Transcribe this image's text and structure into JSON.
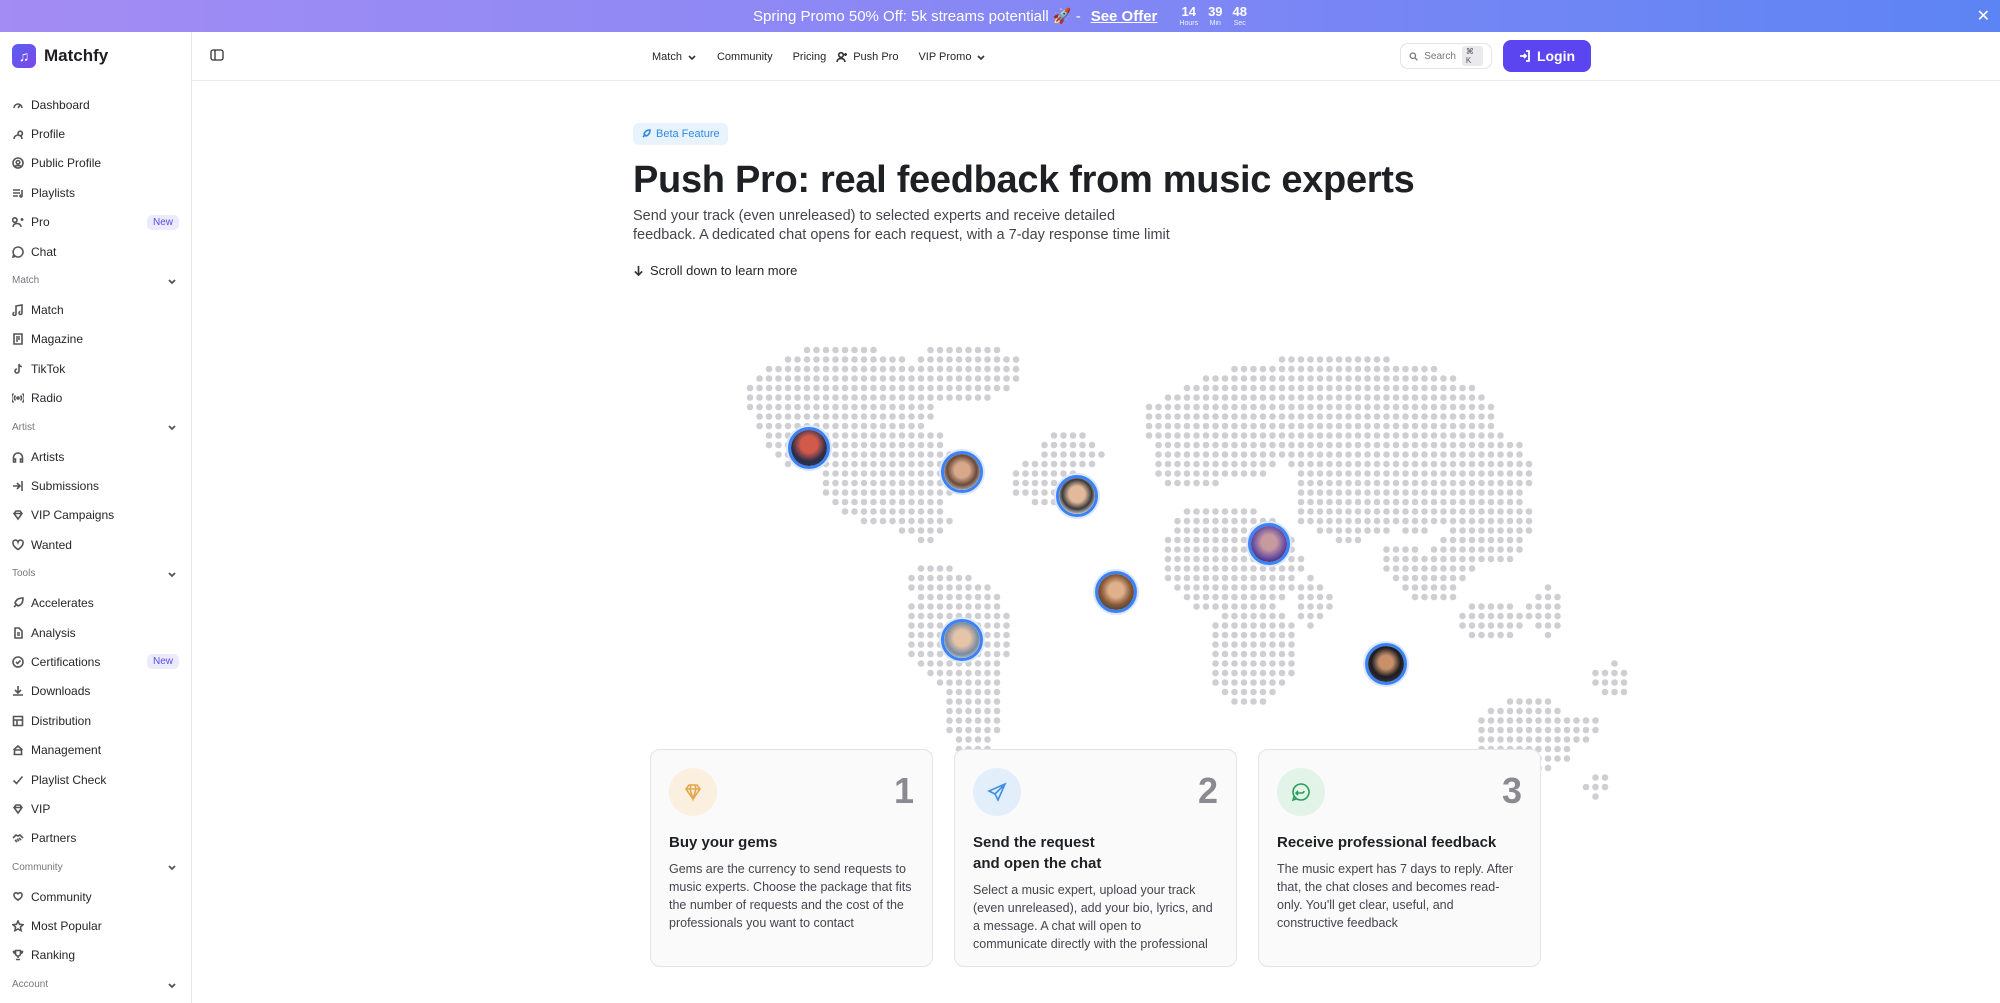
{
  "promo": {
    "text": "Spring Promo 50% Off: 5k streams potentiall 🚀 -",
    "offer": "See Offer",
    "timer": [
      {
        "value": "14",
        "label": "Hours"
      },
      {
        "value": "39",
        "label": "Min"
      },
      {
        "value": "48",
        "label": "Sec"
      }
    ],
    "close": "✕"
  },
  "brand": {
    "name": "Matchfy"
  },
  "sidebar": {
    "main": [
      {
        "label": "Dashboard",
        "icon": "dashboard-icon"
      },
      {
        "label": "Profile",
        "icon": "user-icon"
      },
      {
        "label": "Public Profile",
        "icon": "user-circle-icon"
      },
      {
        "label": "Playlists",
        "icon": "playlist-icon"
      },
      {
        "label": "Pro",
        "icon": "user-plus-icon",
        "badge": "New"
      },
      {
        "label": "Chat",
        "icon": "chat-icon"
      }
    ],
    "sections": [
      {
        "title": "Match",
        "items": [
          {
            "label": "Match",
            "icon": "music-note-icon"
          },
          {
            "label": "Magazine",
            "icon": "magazine-icon"
          },
          {
            "label": "TikTok",
            "icon": "tiktok-icon"
          },
          {
            "label": "Radio",
            "icon": "radio-icon"
          }
        ]
      },
      {
        "title": "Artist",
        "items": [
          {
            "label": "Artists",
            "icon": "headphones-icon"
          },
          {
            "label": "Submissions",
            "icon": "submit-icon"
          },
          {
            "label": "VIP Campaigns",
            "icon": "diamond-icon"
          },
          {
            "label": "Wanted",
            "icon": "heart-icon"
          }
        ]
      },
      {
        "title": "Tools",
        "items": [
          {
            "label": "Accelerates",
            "icon": "rocket-icon"
          },
          {
            "label": "Analysis",
            "icon": "document-icon"
          },
          {
            "label": "Certifications",
            "icon": "certificate-icon",
            "badge": "New"
          },
          {
            "label": "Downloads",
            "icon": "download-icon"
          },
          {
            "label": "Distribution",
            "icon": "distribution-icon"
          },
          {
            "label": "Management",
            "icon": "management-icon"
          },
          {
            "label": "Playlist Check",
            "icon": "check-icon"
          },
          {
            "label": "VIP",
            "icon": "diamond-icon"
          },
          {
            "label": "Partners",
            "icon": "handshake-icon"
          }
        ]
      },
      {
        "title": "Community",
        "items": [
          {
            "label": "Community",
            "icon": "heart-hand-icon"
          },
          {
            "label": "Most Popular",
            "icon": "star-icon"
          },
          {
            "label": "Ranking",
            "icon": "trophy-icon"
          }
        ]
      },
      {
        "title": "Account",
        "items": []
      }
    ]
  },
  "topnav": {
    "match": "Match",
    "community": "Community",
    "pricing": "Pricing",
    "push_pro": "Push Pro",
    "vip_promo": "VIP Promo",
    "search_label": "Search",
    "search_kbd": "⌘ K",
    "login": "Login"
  },
  "hero": {
    "badge": "Beta Feature",
    "title": "Push Pro: real feedback from music experts",
    "subtitle": "Send your track (even unreleased) to selected experts and receive detailed feedback. A dedicated chat opens for each request, with a 7-day response time limit",
    "scroll": "Scroll down to learn more"
  },
  "steps": [
    {
      "num": "1",
      "title": "Buy your gems",
      "body": "Gems are the currency to send requests to music experts. Choose the package that fits the number of requests and the cost of the professionals you want to contact",
      "icon": "gem-icon",
      "color": "#e2a84b",
      "bg": "#fbefe0"
    },
    {
      "num": "2",
      "title": "Send the request and open the chat",
      "body": "Select a music expert, upload your track (even unreleased), add your bio, lyrics, and a message. A chat will open to communicate directly with the professional",
      "icon": "send-icon",
      "color": "#3d8ee6",
      "bg": "#e3eefb"
    },
    {
      "num": "3",
      "title": "Receive professional feedback",
      "body": "The music expert has 7 days to reply. After that, the chat closes and becomes read-only. You'll get clear, useful, and constructive feedback",
      "icon": "feedback-icon",
      "color": "#2b9f5a",
      "bg": "#e2f3e7"
    }
  ]
}
